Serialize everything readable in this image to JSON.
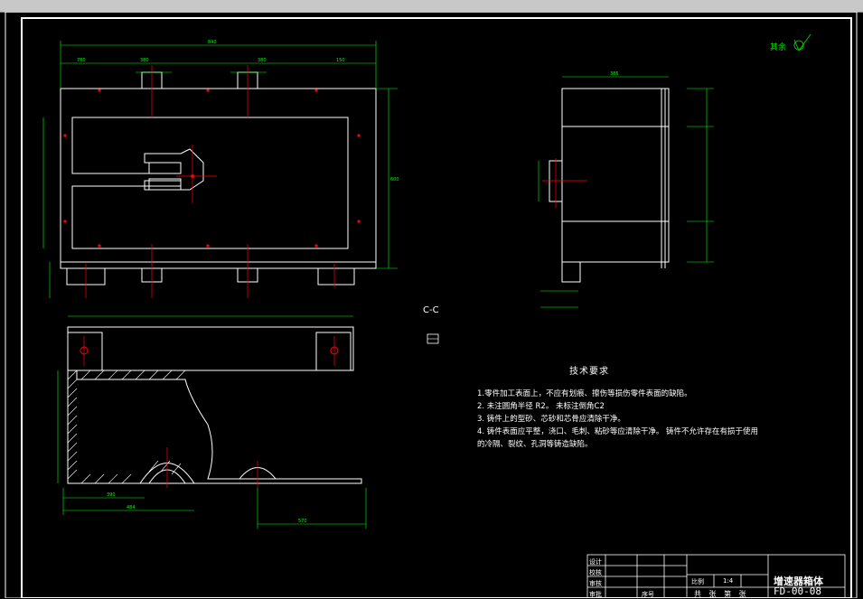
{
  "title_block": {
    "part_name": "增速器箱体",
    "drawing_no": "FD-00-08",
    "scale_label": "比例",
    "scale_value": "1:4",
    "sheet_text": "共 张 第 张",
    "row_labels": [
      "设计",
      "校核",
      "审核",
      "审批"
    ],
    "seq_label": "序号"
  },
  "section_label": "C-C",
  "other_roughness": "其余",
  "requirements": {
    "title": "技术要求",
    "items": [
      "1.零件加工表面上，不应有划痕、擦伤等损伤零件表面的缺陷。",
      "2. 未注圆角半径 R2。 未标注倒角C2",
      "3. 铸件上的型砂、芯砂和芯骨应清除干净。",
      "4. 铸件表面应平整，浇口、毛刺、粘砂等应清除干净。 铸件不允许存在有损于使用",
      "的冷隔、裂纹、孔洞等铸造缺陷。"
    ]
  },
  "dimensions": {
    "top_overall": "840",
    "top_d1": "780",
    "top_d2": "380",
    "top_d3": "380",
    "top_d4": "150",
    "right_height": "600",
    "side_width": "385",
    "bottom_d1": "390",
    "bottom_d2": "484",
    "bottom_d3": "570"
  },
  "colors": {
    "outline": "#ffffff",
    "dimension": "#00ff00",
    "center": "#ff0000",
    "hatch": "#ffffff",
    "ui_bar": "#c8c8c8"
  }
}
